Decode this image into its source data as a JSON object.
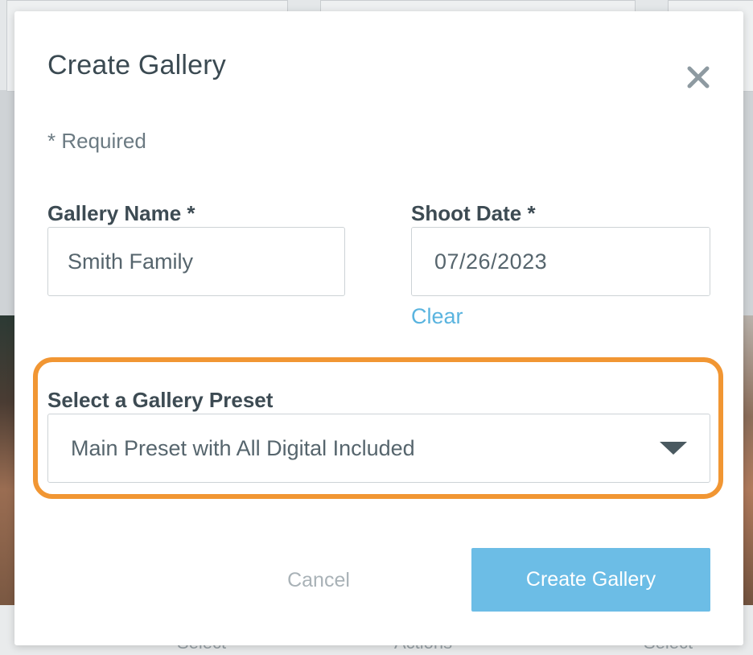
{
  "backdrop": {
    "bottom_labels": [
      "Select",
      "Actions",
      "Select"
    ]
  },
  "modal": {
    "title": "Create Gallery",
    "close_icon": "close-icon",
    "required_note": "* Required",
    "gallery_name": {
      "label": "Gallery Name *",
      "value": "Smith Family"
    },
    "shoot_date": {
      "label": "Shoot Date *",
      "value": "07/26/2023",
      "calendar_icon": "calendar-icon",
      "clear_label": "Clear"
    },
    "preset": {
      "label": "Select a Gallery Preset",
      "selected": "Main Preset with All Digital Included",
      "dropdown_icon": "caret-down-icon"
    },
    "actions": {
      "cancel_label": "Cancel",
      "create_label": "Create Gallery"
    }
  },
  "colors": {
    "accent": "#6cbde6",
    "link": "#5ab4df",
    "highlight": "#f19633",
    "text": "#3d4b53"
  }
}
